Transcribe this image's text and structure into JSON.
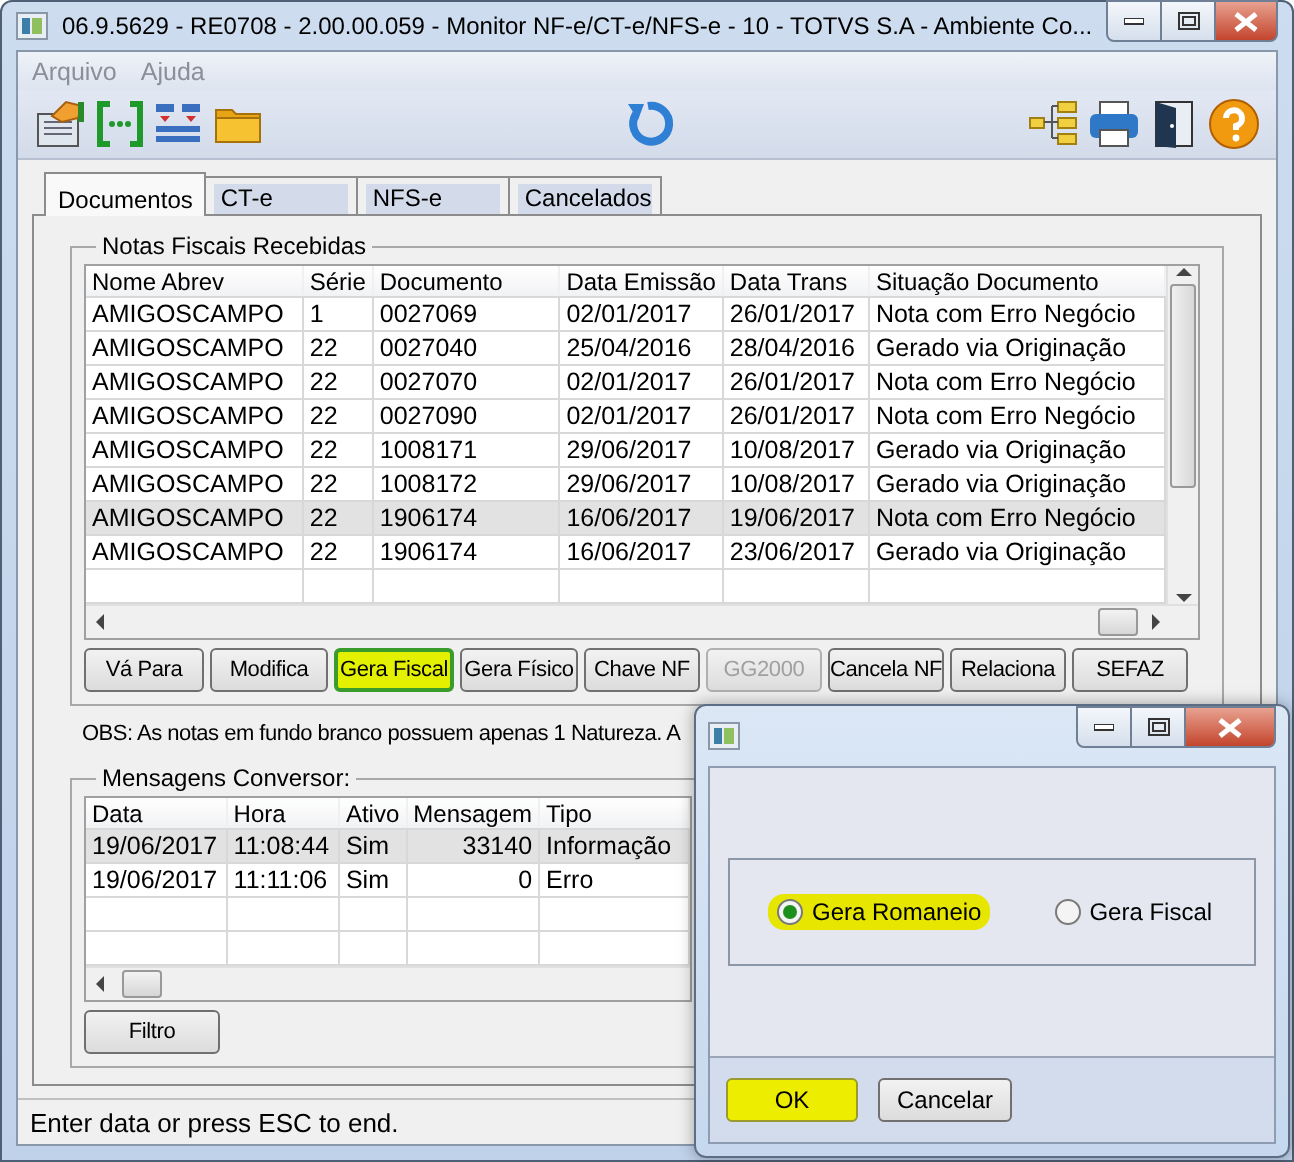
{
  "window": {
    "title": "06.9.5629 - RE0708 - 2.00.00.059 - Monitor NF-e/CT-e/NFS-e - 10 - TOTVS S.A - Ambiente Co..."
  },
  "menu": [
    "Arquivo",
    "Ajuda"
  ],
  "tabs": [
    {
      "label": "Documentos",
      "selected": true
    },
    {
      "label": "CT-e",
      "selected": false
    },
    {
      "label": "NFS-e",
      "selected": false
    },
    {
      "label": "Cancelados",
      "selected": false
    }
  ],
  "notas": {
    "title": "Notas Fiscais Recebidas",
    "columns": [
      "Nome Abrev",
      "Série",
      "Documento",
      "Data Emissão",
      "Data Trans",
      "Situação Documento"
    ],
    "rows": [
      {
        "cells": [
          "AMIGOSCAMPO",
          "1",
          "0027069",
          "02/01/2017",
          "26/01/2017",
          "Nota com Erro Negócio"
        ],
        "selected": false
      },
      {
        "cells": [
          "AMIGOSCAMPO",
          "22",
          "0027040",
          "25/04/2016",
          "28/04/2016",
          "Gerado via Originação"
        ],
        "selected": false
      },
      {
        "cells": [
          "AMIGOSCAMPO",
          "22",
          "0027070",
          "02/01/2017",
          "26/01/2017",
          "Nota com Erro Negócio"
        ],
        "selected": false
      },
      {
        "cells": [
          "AMIGOSCAMPO",
          "22",
          "0027090",
          "02/01/2017",
          "26/01/2017",
          "Nota com Erro Negócio"
        ],
        "selected": false
      },
      {
        "cells": [
          "AMIGOSCAMPO",
          "22",
          "1008171",
          "29/06/2017",
          "10/08/2017",
          "Gerado via Originação"
        ],
        "selected": false
      },
      {
        "cells": [
          "AMIGOSCAMPO",
          "22",
          "1008172",
          "29/06/2017",
          "10/08/2017",
          "Gerado via Originação"
        ],
        "selected": false
      },
      {
        "cells": [
          "AMIGOSCAMPO",
          "22",
          "1906174",
          "16/06/2017",
          "19/06/2017",
          "Nota com Erro Negócio"
        ],
        "selected": true
      },
      {
        "cells": [
          "AMIGOSCAMPO",
          "22",
          "1906174",
          "16/06/2017",
          "23/06/2017",
          "Gerado via Originação"
        ],
        "selected": false
      }
    ]
  },
  "buttons": [
    {
      "label": "Vá Para",
      "disabled": false,
      "highlighted": false
    },
    {
      "label": "Modifica",
      "disabled": false,
      "highlighted": false
    },
    {
      "label": "Gera Fiscal",
      "disabled": false,
      "highlighted": true
    },
    {
      "label": "Gera Físico",
      "disabled": false,
      "highlighted": false
    },
    {
      "label": "Chave NF",
      "disabled": false,
      "highlighted": false
    },
    {
      "label": "GG2000",
      "disabled": true,
      "highlighted": false
    },
    {
      "label": "Cancela NF",
      "disabled": false,
      "highlighted": false
    },
    {
      "label": "Relaciona",
      "disabled": false,
      "highlighted": false
    },
    {
      "label": "SEFAZ",
      "disabled": false,
      "highlighted": false
    }
  ],
  "obs": "OBS: As notas em fundo branco possuem apenas 1 Natureza. A",
  "mensagens": {
    "title": "Mensagens Conversor:",
    "columns": [
      "Data",
      "Hora",
      "Ativo",
      "Mensagem",
      "Tipo"
    ],
    "rows": [
      {
        "cells": [
          "19/06/2017",
          "11:08:44",
          "Sim",
          "33140",
          "Informação"
        ],
        "selected": true
      },
      {
        "cells": [
          "19/06/2017",
          "11:11:06",
          "Sim",
          "0",
          "Erro"
        ],
        "selected": false
      }
    ]
  },
  "filter_button": "Filtro",
  "status_bar": "Enter data or press ESC to end.",
  "dialog": {
    "options": [
      {
        "label": "Gera Romaneio",
        "selected": true,
        "highlighted": true
      },
      {
        "label": "Gera Fiscal",
        "selected": false,
        "highlighted": false
      }
    ],
    "buttons": [
      {
        "label": "OK",
        "highlighted": true
      },
      {
        "label": "Cancelar",
        "highlighted": false
      }
    ]
  }
}
